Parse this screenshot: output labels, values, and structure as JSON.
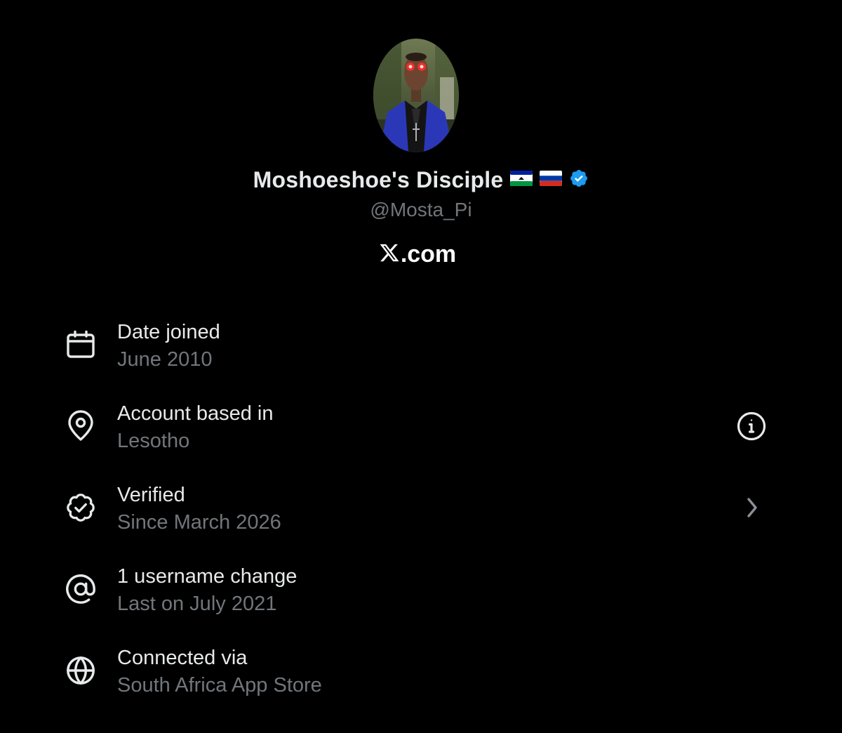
{
  "profile": {
    "display_name": "Moshoeshoe's Disciple",
    "handle": "@Mosta_Pi",
    "flags": [
      "lesotho-flag-icon",
      "russia-flag-icon"
    ],
    "verified_icon": "verified-badge-icon",
    "site_prefix": "X",
    "site_suffix": ".com"
  },
  "rows": [
    {
      "icon": "calendar-icon",
      "title": "Date joined",
      "subtitle": "June 2010"
    },
    {
      "icon": "location-pin-icon",
      "title": "Account based in",
      "subtitle": "Lesotho",
      "action_icon": "info-icon"
    },
    {
      "icon": "verified-check-icon",
      "title": "Verified",
      "subtitle": "Since March 2026",
      "action_icon": "chevron-right-icon"
    },
    {
      "icon": "at-sign-icon",
      "title": "1 username change",
      "subtitle": "Last on July 2021"
    },
    {
      "icon": "globe-icon",
      "title": "Connected via",
      "subtitle": "South Africa App Store"
    }
  ],
  "colors": {
    "background": "#000000",
    "primary_text": "#e7e9ea",
    "secondary_text": "#71767b",
    "verified_blue": "#1d9bf0"
  }
}
